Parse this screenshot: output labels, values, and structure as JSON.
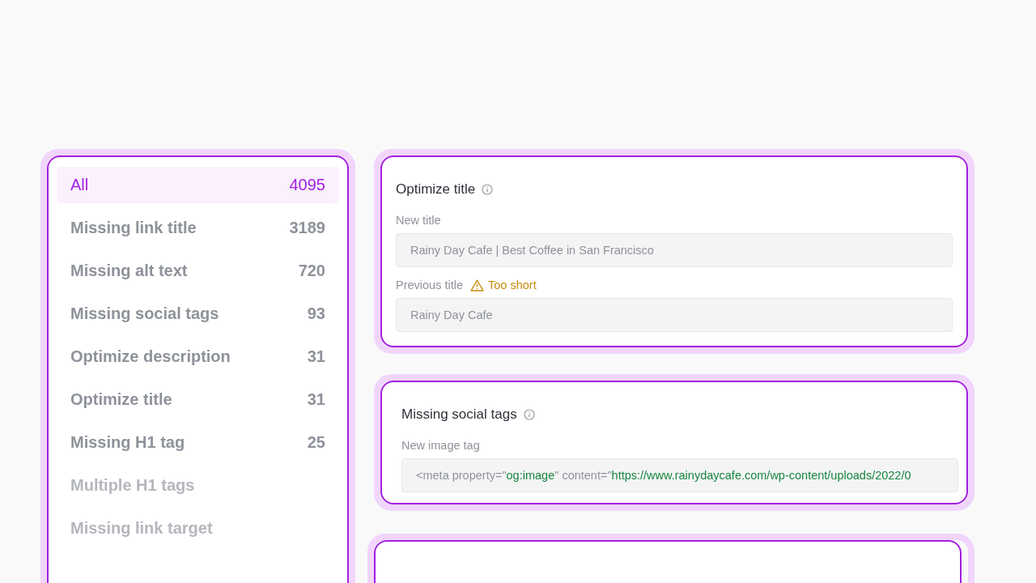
{
  "sidebar": {
    "items": [
      {
        "label": "All",
        "count": "4095",
        "selected": true,
        "disabled": false
      },
      {
        "label": "Missing link title",
        "count": "3189",
        "selected": false,
        "disabled": false
      },
      {
        "label": "Missing alt text",
        "count": "720",
        "selected": false,
        "disabled": false
      },
      {
        "label": "Missing social tags",
        "count": "93",
        "selected": false,
        "disabled": false
      },
      {
        "label": "Optimize description",
        "count": "31",
        "selected": false,
        "disabled": false
      },
      {
        "label": "Optimize title",
        "count": "31",
        "selected": false,
        "disabled": false
      },
      {
        "label": "Missing H1 tag",
        "count": "25",
        "selected": false,
        "disabled": false
      },
      {
        "label": "Multiple H1 tags",
        "selected": false,
        "disabled": true
      },
      {
        "label": "Missing link target",
        "selected": false,
        "disabled": true
      }
    ]
  },
  "cards": [
    {
      "title": "Optimize title",
      "fields": [
        {
          "label": "New title",
          "value": "Rainy Day Cafe | Best Coffee in San Francisco"
        },
        {
          "label": "Previous title",
          "warning": "Too short",
          "value": "Rainy Day Cafe"
        }
      ]
    },
    {
      "title": "Missing social tags",
      "fields": [
        {
          "label": "New image tag",
          "code": [
            {
              "kind": "plain",
              "text": "<meta property=\""
            },
            {
              "kind": "value",
              "text": "og:image"
            },
            {
              "kind": "plain",
              "text": "\" content=\""
            },
            {
              "kind": "value",
              "text": "https://www.rainydaycafe.com/wp-content/uploads/2022/0"
            }
          ]
        }
      ]
    }
  ]
}
